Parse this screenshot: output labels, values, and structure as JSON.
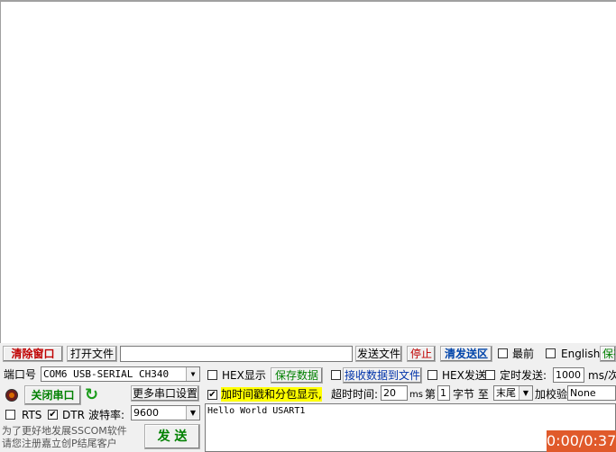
{
  "toolbar": {
    "clear_window": "清除窗口",
    "open_file": "打开文件",
    "file_path": "",
    "send_file": "发送文件",
    "stop": "停止",
    "clear_send": "清发送区",
    "topmost": "最前",
    "english": "English",
    "save_params": "保存参数"
  },
  "port": {
    "port_label": "端口号",
    "port_value": "COM6 USB-SERIAL CH340",
    "close_port": "关闭串口",
    "more_settings": "更多串口设置",
    "rts": "RTS",
    "dtr": "DTR",
    "dtr_checked": true,
    "rts_checked": false,
    "baud_label": "波特率:",
    "baud_value": "9600",
    "promo_line1": "为了更好地发展SSCOM软件",
    "promo_line2": "请您注册嘉立创P结尾客户",
    "send_button": "发 送"
  },
  "options": {
    "hex_display": "HEX显示",
    "save_data": "保存数据",
    "recv_to_file": "接收数据到文件",
    "hex_send": "HEX发送",
    "timed_send": "定时发送:",
    "timed_value": "1000",
    "timed_unit": "ms/次",
    "timestamp": "加时间戳和分包显示,",
    "timestamp_checked": true,
    "timeout_label": "超时时间:",
    "timeout_value": "20",
    "timeout_unit": "ms",
    "nth_label": "第",
    "nth_value": "1",
    "byte_label": "字节 至",
    "end_value": "末尾",
    "checksum_label": "加校验",
    "checksum_value": "None"
  },
  "send_text": "Hello World USART1",
  "timer": "0:00/0:37"
}
